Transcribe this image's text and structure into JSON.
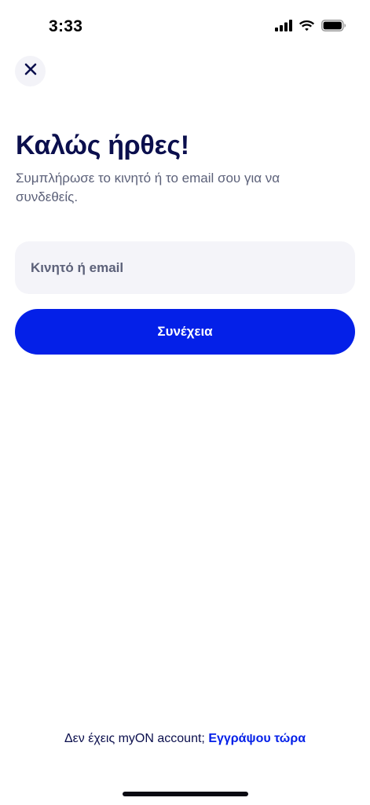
{
  "status_bar": {
    "time": "3:33"
  },
  "icons": {
    "close": "close-icon",
    "signal": "signal-icon",
    "wifi": "wifi-icon",
    "battery": "battery-icon"
  },
  "header": {
    "title": "Καλώς ήρθες!",
    "subtitle": "Συμπλήρωσε το κινητό ή το email σου για να συνδεθείς."
  },
  "form": {
    "input_value": "",
    "input_placeholder": "Κινητό ή email",
    "continue_label": "Συνέχεια"
  },
  "footer": {
    "prompt": "Δεν έχεις myON account;",
    "signup_link": "Εγγράψου τώρα"
  },
  "colors": {
    "primary": "#0420e8",
    "title": "#0b0f4d",
    "subtitle": "#5c6179",
    "input_bg": "#f4f4f9"
  }
}
